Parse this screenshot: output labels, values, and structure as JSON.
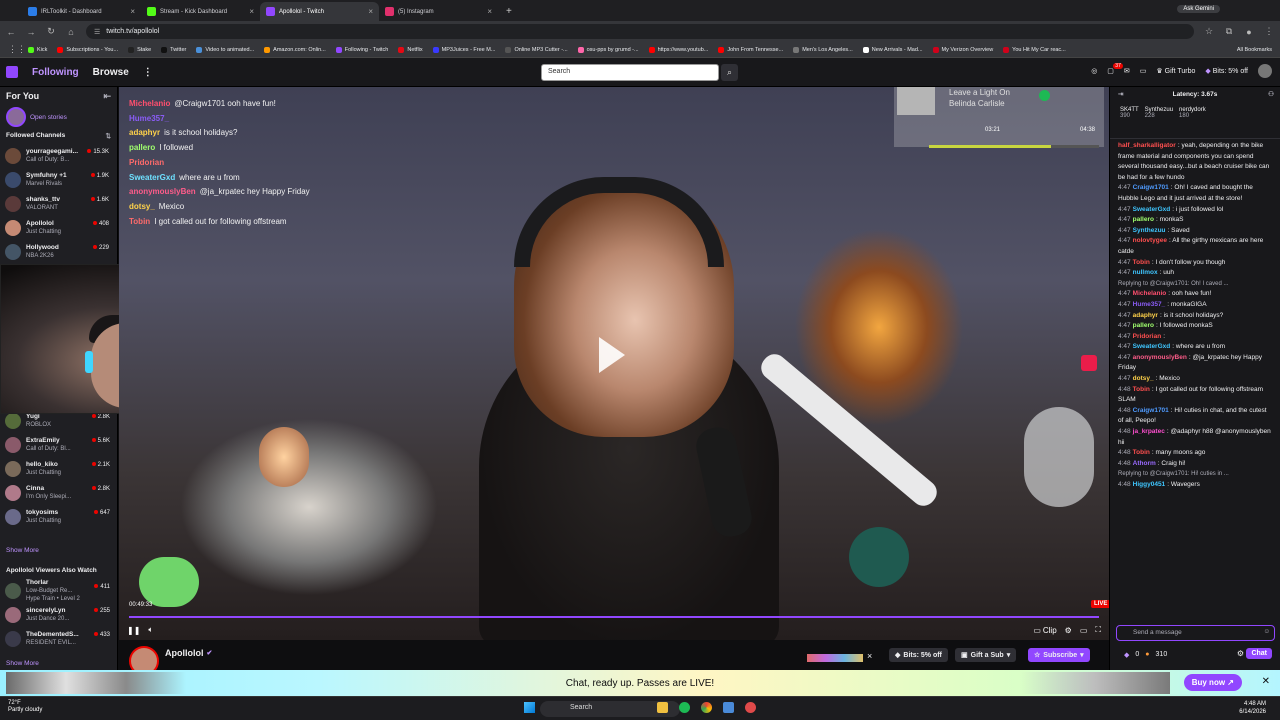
{
  "browser": {
    "tabs": [
      {
        "title": "IRLToolkit - Dashboard",
        "color": "#2b7de9",
        "active": false
      },
      {
        "title": "Stream - Kick Dashboard",
        "color": "#53fc18",
        "active": false
      },
      {
        "title": "Apollolol - Twitch",
        "color": "#9147ff",
        "active": true
      },
      {
        "title": "(5) Instagram",
        "color": "#e1306c",
        "active": false
      }
    ],
    "url": "twitch.tv/apollolol",
    "ask_gemini": "Ask Gemini",
    "bookmarks": [
      "Kick",
      "Subscriptions - You...",
      "Stake",
      "Twitter",
      "Video to animated...",
      "Amazon.com: Onlin...",
      "Following - Twitch",
      "Netflix",
      "MP3Juices - Free M...",
      "Online MP3 Cutter -...",
      "osu-pps by grumd -...",
      "https://www.youtub...",
      "John From Tennesse...",
      "Men's Los Angeles...",
      "New Arrivals - Mad...",
      "My Verizon Overview",
      "You Hit My Car reac..."
    ],
    "all_bookmarks": "All Bookmarks"
  },
  "topnav": {
    "following": "Following",
    "browse": "Browse",
    "search_placeholder": "Search",
    "notif_count": "37",
    "gift_turbo": "Gift Turbo",
    "bits_offer": "Bits: 5% off"
  },
  "sidebar": {
    "for_you": "For You",
    "open_stories": "Open stories",
    "followed_channels": "Followed Channels",
    "followed": [
      {
        "name": "yourrageegami...",
        "game": "Call of Duty: B...",
        "viewers": "15.3K",
        "color": "#6b4a3a"
      },
      {
        "name": "Symfuhny +1",
        "game": "Marvel Rivals",
        "viewers": "1.9K",
        "color": "#3a4a6b"
      },
      {
        "name": "shanks_ttv",
        "game": "VALORANT",
        "viewers": "1.6K",
        "color": "#5a3a3a"
      },
      {
        "name": "Apollolol",
        "game": "Just Chatting",
        "viewers": "408",
        "color": "#c58a74"
      },
      {
        "name": "Hollywood",
        "game": "NBA 2K26",
        "viewers": "229",
        "color": "#445566"
      }
    ],
    "followed_more": [
      {
        "name": "Yugi",
        "game": "ROBLOX",
        "viewers": "2.8K",
        "color": "#556b3a"
      },
      {
        "name": "ExtraEmily",
        "game": "Call of Duty: Bl...",
        "viewers": "5.6K",
        "color": "#8a5a6a"
      },
      {
        "name": "hello_kiko",
        "game": "Just Chatting",
        "viewers": "2.1K",
        "color": "#7a6a5a"
      },
      {
        "name": "Cinna",
        "game": "I'm Only Sleepi...",
        "viewers": "2.8K",
        "color": "#b07a8a"
      },
      {
        "name": "tokyosims",
        "game": "Just Chatting",
        "viewers": "647",
        "color": "#6a6a8a"
      }
    ],
    "show_more": "Show More",
    "also_watch_title": "Apollolol Viewers Also Watch",
    "also_watch": [
      {
        "name": "Thorlar",
        "game": "Low-Budget Re...",
        "viewers": "411",
        "extra": "Hype Train • Level 2",
        "color": "#4a5a4a"
      },
      {
        "name": "sincerelyLyn",
        "game": "Just Dance 20...",
        "viewers": "255",
        "color": "#9a6a7a"
      },
      {
        "name": "TheDementedS...",
        "game": "RESIDENT EVIL...",
        "viewers": "433",
        "color": "#3a3a4a"
      }
    ],
    "show_more_2": "Show More"
  },
  "overlay_chat": [
    {
      "user": "Michelanio",
      "text": "@Craigw1701 ooh have fun!",
      "color": "#ff4f6e"
    },
    {
      "user": "Hume357_",
      "text": "",
      "color": "#8a5cf5"
    },
    {
      "user": "adaphyr",
      "text": "is it school holidays?",
      "color": "#ffd24a"
    },
    {
      "user": "pallero",
      "text": "I followed",
      "color": "#a0ff6e"
    },
    {
      "user": "Pridorian",
      "text": "",
      "color": "#ff6b6b"
    },
    {
      "user": "SweaterGxd",
      "text": "where are u from",
      "color": "#6ee0ff"
    },
    {
      "user": "anonymouslyBen",
      "text": "@ja_krpatec hey Happy Friday",
      "color": "#ff5c8a"
    },
    {
      "user": "dotsy_",
      "text": "Mexico",
      "color": "#ffd24a"
    },
    {
      "user": "Tobin",
      "text": "I got called out for following offstream",
      "color": "#ff6b6b"
    }
  ],
  "now_playing": {
    "line1": "Leave a Light On",
    "line2": "Belinda Carlisle",
    "elapsed": "03:21",
    "total": "04:38",
    "progress": 0.72
  },
  "video": {
    "live": "LIVE",
    "timecode": "00:49:33",
    "clip": "Clip",
    "progress": 1.0
  },
  "channel_info": {
    "name": "Apollolol",
    "bits": "Bits: 5% off",
    "gift_sub": "Gift a Sub",
    "subscribe": "Subscribe"
  },
  "chat": {
    "latency": "Latency: 3.67s",
    "leaderboard": [
      {
        "name": "SK4TT",
        "value": "390"
      },
      {
        "name": "Synthezuu",
        "value": "228"
      },
      {
        "name": "nerdydork",
        "value": "180"
      }
    ],
    "messages": [
      {
        "time": "",
        "user": "half_sharkalligator",
        "text": "yeah, depending on the bike frame material and components you can spend several thousand easy...but a beach cruiser bike can be had for a few hundo",
        "color": "#ff4f4f"
      },
      {
        "time": "4:47",
        "user": "Craigw1701",
        "text": "Oh! I caved and bought the Hubble Lego and it just arrived at the store!",
        "color": "#4f9bff"
      },
      {
        "time": "4:47",
        "user": "SweaterGxd",
        "text": "i just followed lol",
        "color": "#3fc6ff"
      },
      {
        "time": "4:47",
        "user": "pallero",
        "text": "monkaS",
        "color": "#a0ff6e"
      },
      {
        "time": "4:47",
        "user": "Synthezuu",
        "text": "Saved",
        "color": "#3fc6ff"
      },
      {
        "time": "4:47",
        "user": "nolovtygee",
        "text": "All the girthy mexicans are here catde",
        "color": "#ff4f4f"
      },
      {
        "time": "4:47",
        "user": "Tobin",
        "text": "I don't follow you though",
        "color": "#ff4f4f"
      },
      {
        "time": "4:47",
        "user": "nullmox",
        "text": "uuh",
        "color": "#3fc6ff"
      },
      {
        "time": "",
        "user": "",
        "text": "Replying to @Craigw1701: Oh! I caved ...",
        "color": "#adadb8",
        "reply": true
      },
      {
        "time": "4:47",
        "user": "Michelanio",
        "text": "ooh have fun!",
        "color": "#ff4f6e"
      },
      {
        "time": "4:47",
        "user": "Hume357_",
        "text": "monkaGIGA",
        "color": "#8a5cf5"
      },
      {
        "time": "4:47",
        "user": "adaphyr",
        "text": "is it school holidays?",
        "color": "#ffd24a"
      },
      {
        "time": "4:47",
        "user": "pallero",
        "text": "I followed monkaS",
        "color": "#a0ff6e"
      },
      {
        "time": "4:47",
        "user": "Pridorian",
        "text": "",
        "color": "#ff4f4f"
      },
      {
        "time": "4:47",
        "user": "SweaterGxd",
        "text": "where are u from",
        "color": "#3fc6ff"
      },
      {
        "time": "4:47",
        "user": "anonymouslyBen",
        "text": "@ja_krpatec hey Happy Friday",
        "color": "#ff5c8a"
      },
      {
        "time": "4:47",
        "user": "dotsy_",
        "text": "Mexico",
        "color": "#ffd24a"
      },
      {
        "time": "4:48",
        "user": "Tobin",
        "text": "I got called out for following offstream SLAM",
        "color": "#ff4f4f"
      },
      {
        "time": "4:48",
        "user": "Craigw1701",
        "text": "Hi! cuties in chat, and the cutest of all, Peepo!",
        "color": "#4f9bff"
      },
      {
        "time": "4:48",
        "user": "ja_krpatec",
        "text": "@adaphyr h88 @anonymouslyben hii",
        "color": "#ff4fd0"
      },
      {
        "time": "4:48",
        "user": "Tobin",
        "text": "many moons ago",
        "color": "#ff4f4f"
      },
      {
        "time": "4:48",
        "user": "Athorm",
        "text": "Craig hi!",
        "color": "#9a6aff"
      },
      {
        "time": "",
        "user": "",
        "text": "Replying to @Craigw1701: Hi! cuties in ...",
        "color": "#adadb8",
        "reply": true
      },
      {
        "time": "4:48",
        "user": "Higgy0451",
        "text": "Wavegers",
        "color": "#3fc6ff"
      }
    ],
    "input_placeholder": "Send a message",
    "points": "0",
    "bits": "310",
    "chat_button": "Chat"
  },
  "promo": {
    "text": "Chat, ready up. Passes are LIVE!",
    "buy_now": "Buy now"
  },
  "taskbar": {
    "temp": "72°F",
    "weather": "Partly cloudy",
    "search": "Search",
    "time": "4:48 AM",
    "date": "6/14/2026"
  }
}
